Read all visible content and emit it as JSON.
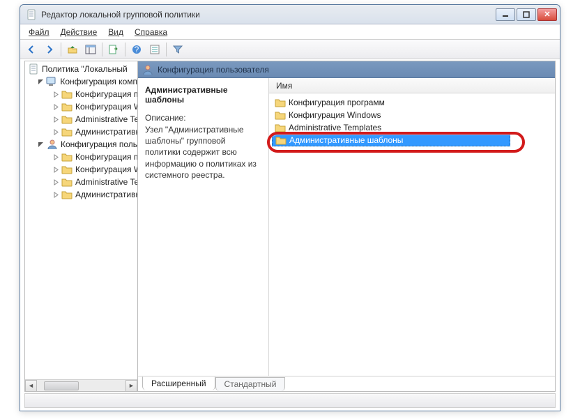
{
  "window": {
    "title": "Редактор локальной групповой политики"
  },
  "menu": {
    "file": "Файл",
    "action": "Действие",
    "view": "Вид",
    "help": "Справка"
  },
  "toolbar_icons": [
    "back",
    "forward",
    "up",
    "panes",
    "export",
    "help",
    "properties",
    "filter"
  ],
  "tree": {
    "root": "Политика \"Локальный",
    "comp": "Конфигурация комп",
    "comp_children": [
      "Конфигурация п",
      "Конфигурация W",
      "Administrative Te",
      "Административн"
    ],
    "user": "Конфигурация поль",
    "user_children": [
      "Конфигурация п",
      "Конфигурация W",
      "Administrative Te",
      "Административн"
    ]
  },
  "header": {
    "text": "Конфигурация пользователя"
  },
  "description": {
    "title": "Административные шаблоны",
    "label": "Описание:",
    "text": "Узел \"Административные шаблоны\" групповой политики содержит всю информацию о политиках из системного реестра."
  },
  "list": {
    "column": "Имя",
    "items": [
      {
        "label": "Конфигурация программ",
        "selected": false
      },
      {
        "label": "Конфигурация Windows",
        "selected": false
      },
      {
        "label": "Administrative Templates",
        "selected": false
      },
      {
        "label": "Административные шаблоны",
        "selected": true
      }
    ]
  },
  "tabs": {
    "extended": "Расширенный",
    "standard": "Стандартный"
  }
}
